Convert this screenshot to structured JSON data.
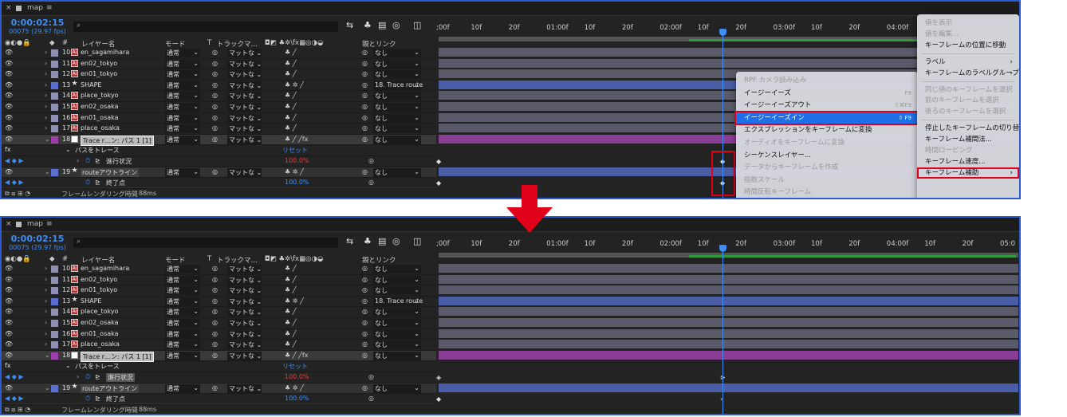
{
  "tab": {
    "close": "×",
    "name": "map",
    "menu": "≡"
  },
  "timecode": "0:00:02:15",
  "fps": "00075 (29.97 fps)",
  "search_icon": "⌕",
  "headers": {
    "layer_name": "レイヤー名",
    "mode": "モード",
    "t": "T",
    "track_matte": "トラックマ…",
    "parent": "親とリンク",
    "num": "#"
  },
  "ruler": [
    ";00f",
    "10f",
    "20f",
    "01:00f",
    "10f",
    "20f",
    "02:00f",
    "10f",
    "20f",
    "03:00f",
    "10f",
    "20f",
    "04:00f",
    "10f",
    "20f",
    "05:0"
  ],
  "layers": [
    {
      "num": "10",
      "name": "en_sagamihara",
      "mode": "通常",
      "track": "マットな",
      "parent": "なし",
      "color": "#8f8fb3",
      "kind": "ai"
    },
    {
      "num": "11",
      "name": "en02_tokyo",
      "mode": "通常",
      "track": "マットな",
      "parent": "なし",
      "color": "#8f8fb3",
      "kind": "ai"
    },
    {
      "num": "12",
      "name": "en01_tokyo",
      "mode": "通常",
      "track": "マットな",
      "parent": "なし",
      "color": "#8f8fb3",
      "kind": "ai"
    },
    {
      "num": "13",
      "name": "SHAPE",
      "mode": "通常",
      "track": "マットな",
      "parent": "18. Trace route",
      "color": "#5a6fd0",
      "kind": "star"
    },
    {
      "num": "14",
      "name": "place_tokyo",
      "mode": "通常",
      "track": "マットな",
      "parent": "なし",
      "color": "#8f8fb3",
      "kind": "ai"
    },
    {
      "num": "15",
      "name": "en02_osaka",
      "mode": "通常",
      "track": "マットな",
      "parent": "なし",
      "color": "#8f8fb3",
      "kind": "ai"
    },
    {
      "num": "16",
      "name": "en01_osaka",
      "mode": "通常",
      "track": "マットな",
      "parent": "なし",
      "color": "#8f8fb3",
      "kind": "ai"
    },
    {
      "num": "17",
      "name": "place_osaka",
      "mode": "通常",
      "track": "マットな",
      "parent": "なし",
      "color": "#8f8fb3",
      "kind": "ai"
    },
    {
      "num": "18",
      "name": "Trace r…ン: パス 1 [1]",
      "mode": "通常",
      "track": "マットな",
      "parent": "なし",
      "color": "#9c3fa8",
      "kind": "null"
    }
  ],
  "sub": {
    "fx": "fx",
    "effect": "パスをトレース",
    "reset": "リセット",
    "prop1": "進行状況",
    "prop1_val": "100.0%",
    "prop2": "終了点",
    "prop2_val": "100.0%"
  },
  "layer19": {
    "num": "19",
    "name": "routeアウトライン",
    "mode": "通常",
    "track": "マットな",
    "parent": "なし",
    "color": "#5a6fd0"
  },
  "render_time": "フレームレンダリング時間",
  "render_ms": "88ms",
  "menu1": [
    {
      "label": "RPF カメラ読み込み",
      "dis": true
    },
    {
      "label": "イージーイーズ",
      "key": "F9"
    },
    {
      "label": "イージーイーズアウト",
      "key": "⇧⌘F9"
    },
    {
      "label": "イージーイーズイン",
      "key": "⇧ F9",
      "sel": true
    },
    {
      "label": "エクスプレッションをキーフレームに変換"
    },
    {
      "label": "オーディオをキーフレームに変換",
      "dis": true
    },
    {
      "label": "シーケンスレイヤー..."
    },
    {
      "label": "データからキーフレームを作成",
      "dis": true
    },
    {
      "label": "指数スケール",
      "dis": true
    },
    {
      "label": "時間反転キーフレーム",
      "dis": true
    }
  ],
  "menu2": [
    {
      "label": "値を表示",
      "dis": true
    },
    {
      "label": "値を編集...",
      "dis": true
    },
    {
      "label": "キーフレームの位置に移動"
    },
    {
      "sep": true
    },
    {
      "label": "ラベル",
      "arr": true
    },
    {
      "label": "キーフレームのラベルグループを選択",
      "arr": true
    },
    {
      "sep": true
    },
    {
      "label": "同じ値のキーフレームを選択",
      "dis": true
    },
    {
      "label": "前のキーフレームを選択",
      "dis": true
    },
    {
      "label": "後ろのキーフレームを選択",
      "dis": true
    },
    {
      "sep": true
    },
    {
      "label": "停止したキーフレームの切り替え"
    },
    {
      "label": "キーフレーム補間法..."
    },
    {
      "label": "時間ロービング",
      "dis": true
    },
    {
      "label": "キーフレーム速度..."
    },
    {
      "label": "キーフレーム補助",
      "arr": true
    }
  ],
  "arrow_color": "#e0001a"
}
